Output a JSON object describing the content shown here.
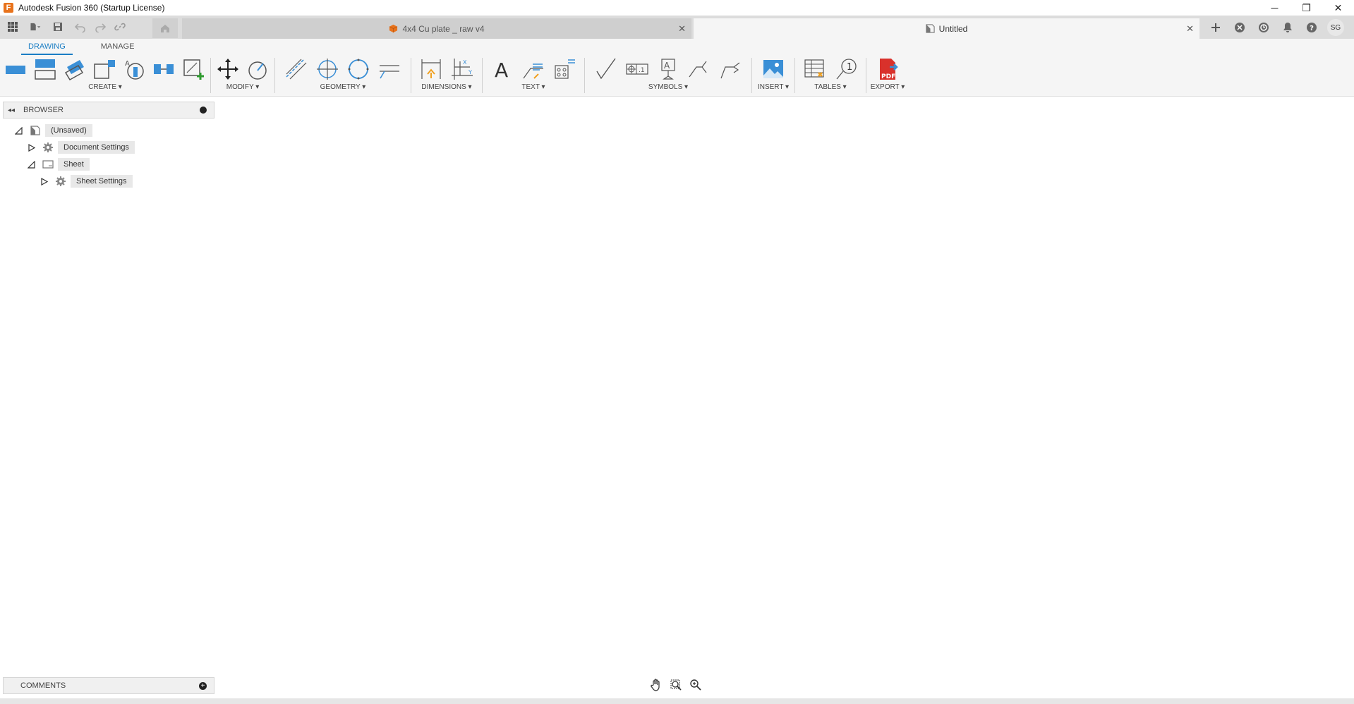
{
  "window": {
    "title": "Autodesk Fusion 360 (Startup License)",
    "minimize": "─",
    "restore": "❐",
    "close": "✕"
  },
  "tabs": [
    {
      "label": "4x4 Cu plate _ raw v4",
      "active": false
    },
    {
      "label": "Untitled",
      "active": true
    }
  ],
  "tab_close": "✕",
  "user": {
    "initials": "SG"
  },
  "workspace_tabs": [
    "DRAWING",
    "MANAGE"
  ],
  "toolbar_groups": {
    "create": "CREATE ▾",
    "modify": "MODIFY ▾",
    "geometry": "GEOMETRY ▾",
    "dimensions": "DIMENSIONS ▾",
    "text": "TEXT ▾",
    "symbols": "SYMBOLS ▾",
    "insert": "INSERT ▾",
    "tables": "TABLES ▾",
    "export": "EXPORT ▾"
  },
  "browser": {
    "title": "BROWSER",
    "collapse": "◂◂",
    "tree": {
      "root": "(Unsaved)",
      "document_settings": "Document Settings",
      "sheet": "Sheet",
      "sheet_settings": "Sheet Settings"
    }
  },
  "comments": {
    "title": "COMMENTS",
    "add": "+"
  },
  "colors": {
    "accent": "#1a7dc4",
    "logo": "#e8731c",
    "pdf_red": "#d9312b"
  }
}
